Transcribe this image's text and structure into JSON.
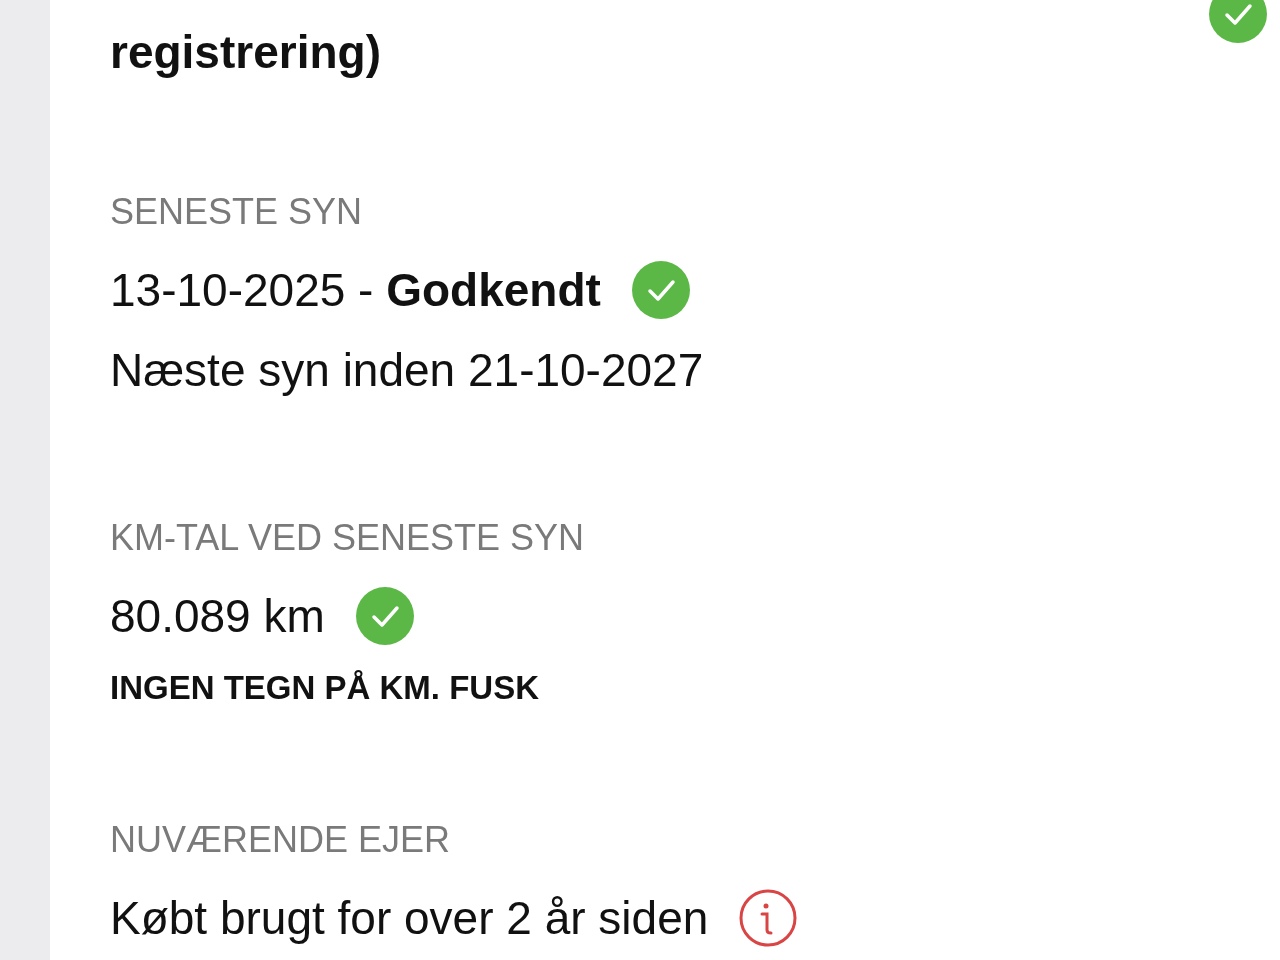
{
  "header": {
    "title": "registrering)",
    "icon": {
      "kind": "check"
    }
  },
  "sections": [
    {
      "label": "SENESTE SYN",
      "lines": [
        {
          "kind": "value",
          "text": "13-10-2025 - **Godkendt**",
          "icon": {
            "kind": "check"
          }
        },
        {
          "kind": "value",
          "text": "Næste syn inden 21-10-2027"
        }
      ]
    },
    {
      "label": "KM-TAL VED SENESTE SYN",
      "lines": [
        {
          "kind": "value",
          "text": "80.089 km",
          "icon": {
            "kind": "check"
          }
        },
        {
          "kind": "note",
          "text": "INGEN TEGN PÅ KM. FUSK"
        }
      ]
    },
    {
      "label": "NUVÆRENDE EJER",
      "lines": [
        {
          "kind": "value",
          "text": "Købt brugt for over 2 år siden",
          "icon": {
            "kind": "info"
          }
        }
      ]
    }
  ]
}
